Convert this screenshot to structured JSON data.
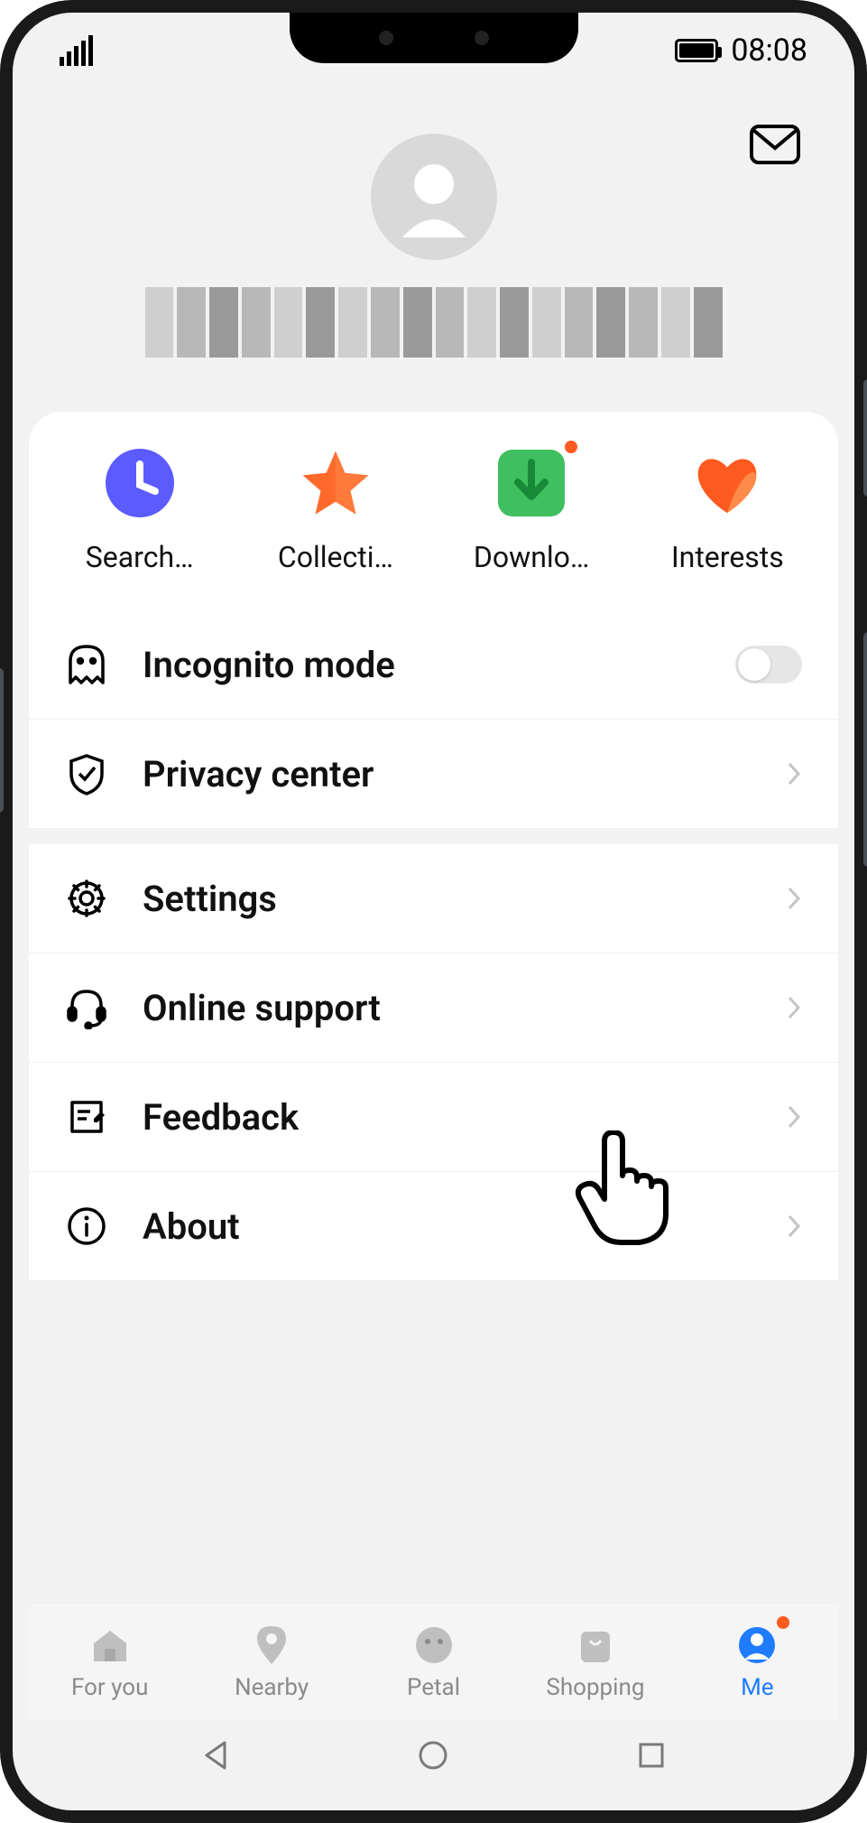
{
  "status": {
    "time": "08:08"
  },
  "quick": [
    {
      "label": "Search…",
      "icon": "clock"
    },
    {
      "label": "Collecti…",
      "icon": "star"
    },
    {
      "label": "Downlo…",
      "icon": "download",
      "badge": true
    },
    {
      "label": "Interests",
      "icon": "heart"
    }
  ],
  "menu1": [
    {
      "label": "Incognito mode",
      "icon": "ghost",
      "toggle": true
    },
    {
      "label": "Privacy center",
      "icon": "shield",
      "chevron": true
    }
  ],
  "menu2": [
    {
      "label": "Settings",
      "icon": "gear",
      "chevron": true
    },
    {
      "label": "Online support",
      "icon": "headset",
      "chevron": true
    },
    {
      "label": "Feedback",
      "icon": "feedback",
      "chevron": true
    },
    {
      "label": "About",
      "icon": "info",
      "chevron": true
    }
  ],
  "tabs": [
    {
      "label": "For you",
      "icon": "home"
    },
    {
      "label": "Nearby",
      "icon": "pin"
    },
    {
      "label": "Petal",
      "icon": "face"
    },
    {
      "label": "Shopping",
      "icon": "bag"
    },
    {
      "label": "Me",
      "icon": "person",
      "active": true,
      "badge": true
    }
  ]
}
